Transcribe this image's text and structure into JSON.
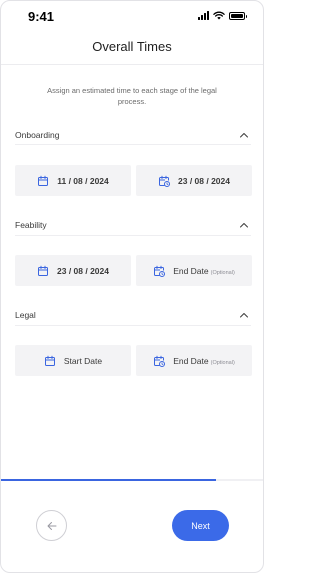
{
  "status_bar": {
    "time": "9:41"
  },
  "header": {
    "title": "Overall Times"
  },
  "intro": {
    "text": "Assign an estimated time to each stage of the legal process."
  },
  "sections": [
    {
      "label": "Onboarding",
      "start": {
        "text": "11 / 08 / 2024",
        "filled": true
      },
      "end": {
        "text": "23 / 08 / 2024",
        "filled": true,
        "optional_text": ""
      }
    },
    {
      "label": "Feability",
      "start": {
        "text": "23 / 08 / 2024",
        "filled": true
      },
      "end": {
        "text": "End Date",
        "filled": false,
        "optional_text": "(Optional)"
      }
    },
    {
      "label": "Legal",
      "start": {
        "text": "Start Date",
        "filled": false
      },
      "end": {
        "text": "End Date",
        "filled": false,
        "optional_text": "(Optional)"
      }
    }
  ],
  "progress": {
    "fraction": 0.82
  },
  "footer": {
    "next_label": "Next"
  },
  "colors": {
    "accent": "#3b6ae8",
    "field_bg": "#f3f3f5",
    "icon": "#3a65e0"
  }
}
